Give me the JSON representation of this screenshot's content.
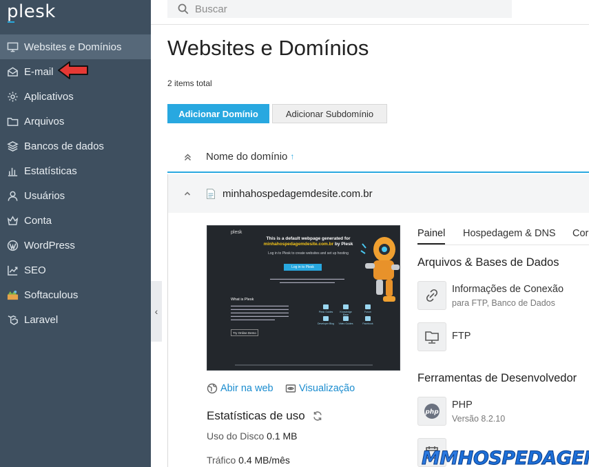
{
  "brand": {
    "logo": "plesk",
    "watermark_prefix": "MM",
    "watermark_main": "HOSPEDAGEM"
  },
  "search": {
    "placeholder": "Buscar"
  },
  "sidebar": {
    "items": [
      {
        "label": "Websites e Domínios",
        "icon": "monitor-icon",
        "active": true
      },
      {
        "label": "E-mail",
        "icon": "mail-icon"
      },
      {
        "label": "Aplicativos",
        "icon": "gear-icon"
      },
      {
        "label": "Arquivos",
        "icon": "folder-icon"
      },
      {
        "label": "Bancos de dados",
        "icon": "database-icon"
      },
      {
        "label": "Estatísticas",
        "icon": "bar-chart-icon"
      },
      {
        "label": "Usuários",
        "icon": "user-icon"
      },
      {
        "label": "Conta",
        "icon": "crown-icon"
      },
      {
        "label": "WordPress",
        "icon": "wordpress-icon"
      },
      {
        "label": "SEO",
        "icon": "seo-chart-icon"
      },
      {
        "label": "Softaculous",
        "icon": "softaculous-icon"
      },
      {
        "label": "Laravel",
        "icon": "laravel-icon"
      }
    ]
  },
  "main": {
    "title": "Websites e Domínios",
    "items_total": "2 items total",
    "add_domain": "Adicionar Domínio",
    "add_subdomain": "Adicionar Subdomínio",
    "column_domain": "Nome do domínio",
    "sort_arrow": "↑"
  },
  "domain": {
    "name": "minhahospedagemdesite.com.br",
    "open_web": "Abir na web",
    "preview_link": "Visualização",
    "stats_title": "Estatísticas de uso",
    "disk_label": "Uso do Disco",
    "disk_value": "0.1 MB",
    "traffic_label": "Tráfico",
    "traffic_value": "0.4 MB/mês",
    "tabs": [
      "Painel",
      "Hospedagem & DNS",
      "Cor"
    ],
    "section_files": "Arquivos & Bases de Dados",
    "tool_conn_name": "Informações de Conexão",
    "tool_conn_sub": "para FTP, Banco de Dados",
    "tool_ftp_name": "FTP",
    "section_dev": "Ferramentas de Desenvolvedor",
    "tool_php_name": "PHP",
    "tool_php_sub": "Versão 8.2.10",
    "tool_php_icon_text": "php"
  },
  "preview": {
    "logo": "plesk",
    "headline": "This is a default webpage generated for",
    "domain": "minhahospedagemdesite.com.br",
    "headline_suffix": "by Plesk",
    "intro": "Log in to Plesk to create websites and set up hosting",
    "login_btn": "Log in to Plesk",
    "what_is": "What is Plesk",
    "demo_btn": "Try Online Demo",
    "links": [
      "Plesk Guides",
      "Knowledge Base",
      "Forum",
      "Developer Blog",
      "Video Guides",
      "Facebook"
    ]
  },
  "colors": {
    "sidebar": "#3e4f5f",
    "accent": "#28a8e0",
    "arrow": "#e53935"
  }
}
